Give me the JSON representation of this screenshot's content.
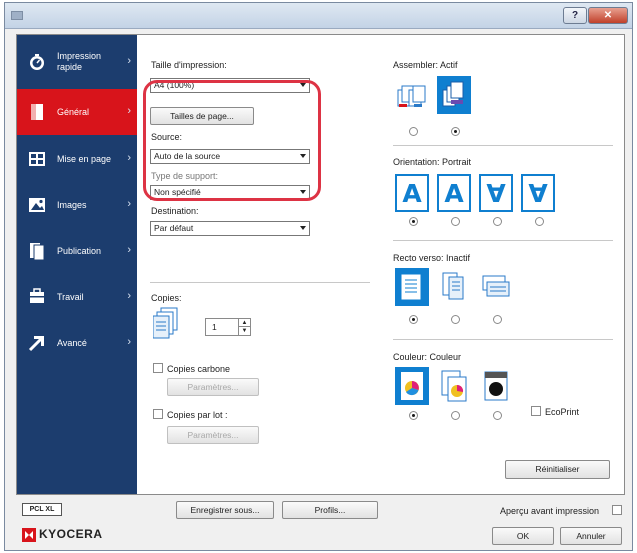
{
  "window": {
    "help_label": "?",
    "close_label": "✕"
  },
  "sidebar": {
    "items": [
      {
        "label": "Impression rapide",
        "icon": "quick-print-icon"
      },
      {
        "label": "Général",
        "icon": "general-icon"
      },
      {
        "label": "Mise en page",
        "icon": "layout-icon"
      },
      {
        "label": "Images",
        "icon": "images-icon"
      },
      {
        "label": "Publication",
        "icon": "publishing-icon"
      },
      {
        "label": "Travail",
        "icon": "job-icon"
      },
      {
        "label": "Avancé",
        "icon": "advanced-icon"
      }
    ],
    "active_index": 1
  },
  "general": {
    "print_size_label": "Taille d'impression:",
    "print_size_value": "A4 (100%)",
    "page_sizes_button": "Tailles de page...",
    "source_label": "Source:",
    "source_value": "Auto de la source",
    "media_type_label": "Type de support:",
    "media_type_value": "Non spécifié",
    "destination_label": "Destination:",
    "destination_value": "Par défaut",
    "copies_label": "Copies:",
    "copies_value": "1",
    "carbon_copies_label": "Copies carbone",
    "carbon_settings_button": "Paramètres...",
    "copies_per_tray_label": "Copies par lot :",
    "tray_settings_button": "Paramètres...",
    "collate_label": "Assembler: Actif",
    "orientation_label": "Orientation: Portrait",
    "duplex_label": "Recto verso: Inactif",
    "color_label": "Couleur: Couleur",
    "ecoprint_label": "EcoPrint",
    "reset_button": "Réinitialiser",
    "orientation_letter": "A"
  },
  "footer": {
    "pdl_badge": "PCL XL",
    "save_as_button": "Enregistrer sous...",
    "profiles_button": "Profils...",
    "preview_label": "Aperçu avant impression",
    "brand": "KYOCERA",
    "ok_button": "OK",
    "cancel_button": "Annuler"
  },
  "colors": {
    "sidebar_bg": "#1c3d6e",
    "active_item": "#d8141b",
    "selection_blue": "#0f7fd0",
    "highlight_ring": "#dd3344",
    "brand_red": "#d8141b"
  }
}
